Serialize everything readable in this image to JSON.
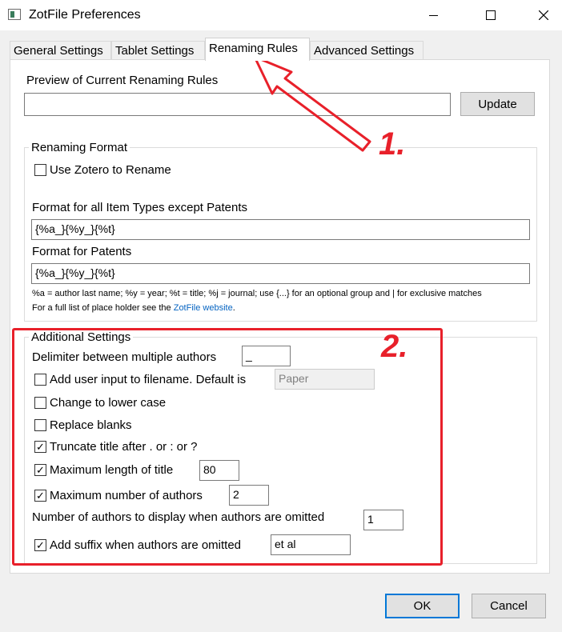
{
  "window": {
    "title": "ZotFile Preferences",
    "minimize_icon": "minimize-icon",
    "maximize_icon": "maximize-icon",
    "close_icon": "close-icon"
  },
  "tabs": [
    {
      "label": "General Settings",
      "active": false
    },
    {
      "label": "Tablet Settings",
      "active": false
    },
    {
      "label": "Renaming Rules",
      "active": true
    },
    {
      "label": "Advanced Settings",
      "active": false
    }
  ],
  "preview": {
    "label": "Preview of Current Renaming Rules",
    "value": "",
    "update_button": "Update"
  },
  "renaming_format": {
    "legend": "Renaming Format",
    "use_zotero_label": "Use Zotero to Rename",
    "use_zotero_checked": false,
    "all_types_label": "Format for all Item Types except Patents",
    "all_types_value": "{%a_}{%y_}{%t}",
    "patents_label": "Format for Patents",
    "patents_value": "{%a_}{%y_}{%t}",
    "help_line1": "%a = author last name; %y = year; %t = title; %j = journal; use {...} for an optional group and | for exclusive matches",
    "help_line2_prefix": "For a full list of place holder see the ",
    "help_link": "ZotFile website",
    "help_line2_suffix": "."
  },
  "additional": {
    "legend": "Additional Settings",
    "delimiter_label": "Delimiter between multiple authors",
    "delimiter_value": "_",
    "user_input_label": "Add user input to filename. Default is",
    "user_input_checked": false,
    "user_input_value": "Paper",
    "lower_case_label": "Change to lower case",
    "lower_case_checked": false,
    "replace_blanks_label": "Replace blanks",
    "replace_blanks_checked": false,
    "truncate_label": "Truncate title after . or : or ?",
    "truncate_checked": true,
    "max_title_label": "Maximum length of title",
    "max_title_checked": true,
    "max_title_value": "80",
    "max_authors_label": "Maximum number of authors",
    "max_authors_checked": true,
    "max_authors_value": "2",
    "num_authors_label": "Number of authors to display when authors are omitted",
    "num_authors_value": "1",
    "suffix_label": "Add suffix when authors are omitted",
    "suffix_checked": true,
    "suffix_value": "et al"
  },
  "footer": {
    "ok": "OK",
    "cancel": "Cancel"
  },
  "annotations": {
    "step1": "1.",
    "step2": "2.",
    "color": "#e8202a"
  },
  "colors": {
    "accent": "#0078d7",
    "link": "#0563c1"
  }
}
